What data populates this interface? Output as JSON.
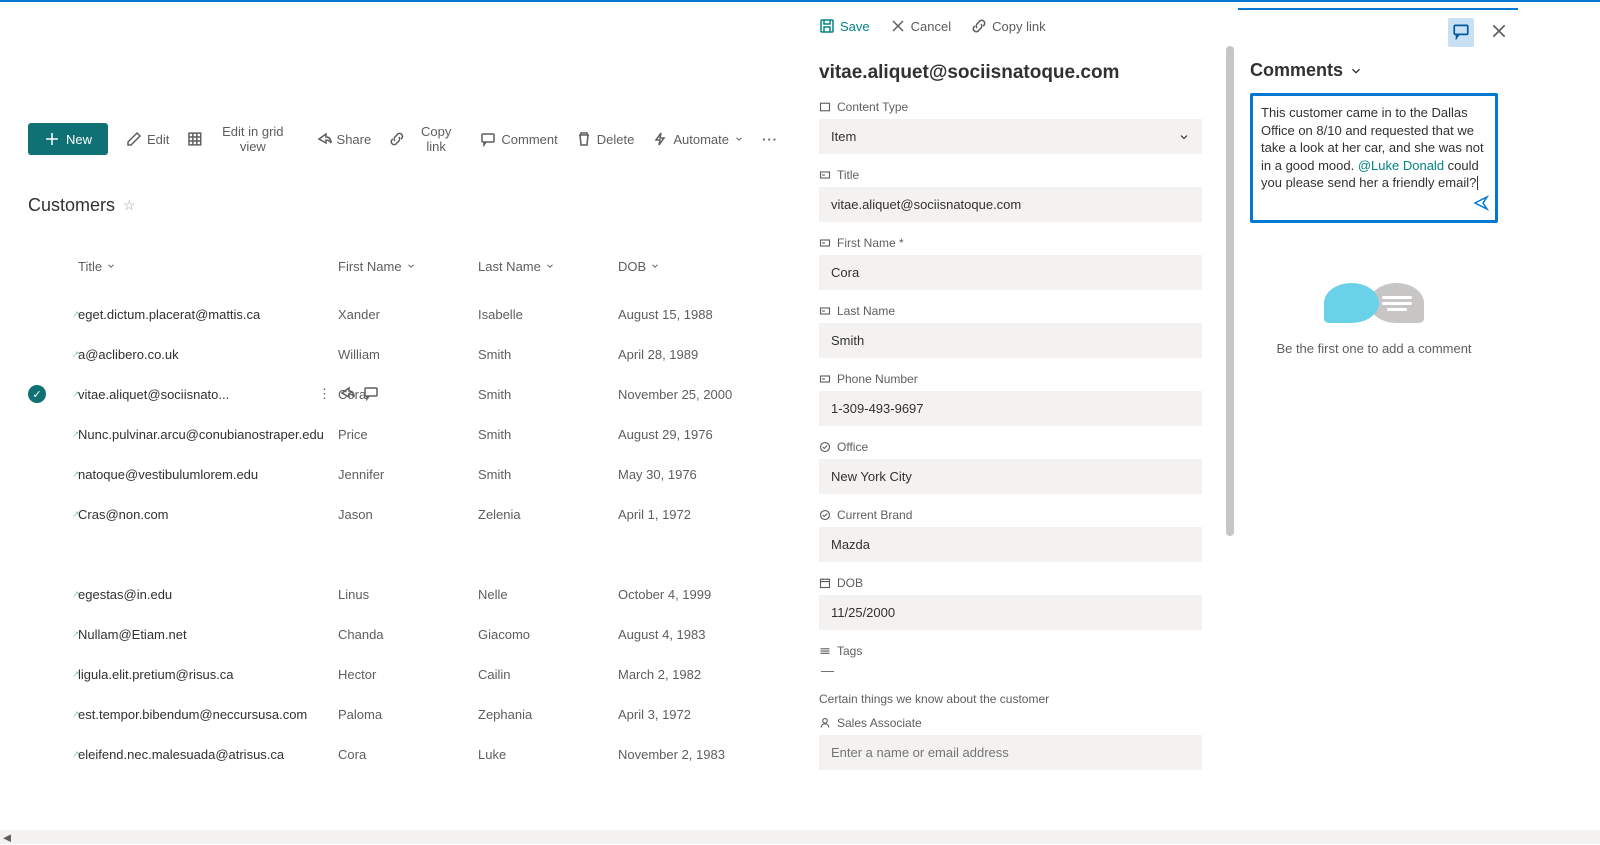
{
  "toolbar": {
    "new": "New",
    "edit": "Edit",
    "editGrid": "Edit in grid view",
    "share": "Share",
    "copyLink": "Copy link",
    "comment": "Comment",
    "delete": "Delete",
    "automate": "Automate"
  },
  "list": {
    "title": "Customers",
    "columns": {
      "title": "Title",
      "firstName": "First Name",
      "lastName": "Last Name",
      "dob": "DOB"
    },
    "rows": [
      {
        "title": "eget.dictum.placerat@mattis.ca",
        "first": "Xander",
        "last": "Isabelle",
        "dob": "August 15, 1988"
      },
      {
        "title": "a@aclibero.co.uk",
        "first": "William",
        "last": "Smith",
        "dob": "April 28, 1989"
      },
      {
        "title": "vitae.aliquet@sociisnato...",
        "first": "Cora",
        "last": "Smith",
        "dob": "November 25, 2000",
        "selected": true
      },
      {
        "title": "Nunc.pulvinar.arcu@conubianostraper.edu",
        "first": "Price",
        "last": "Smith",
        "dob": "August 29, 1976"
      },
      {
        "title": "natoque@vestibulumlorem.edu",
        "first": "Jennifer",
        "last": "Smith",
        "dob": "May 30, 1976"
      },
      {
        "title": "Cras@non.com",
        "first": "Jason",
        "last": "Zelenia",
        "dob": "April 1, 1972"
      },
      {
        "title": "egestas@in.edu",
        "first": "Linus",
        "last": "Nelle",
        "dob": "October 4, 1999"
      },
      {
        "title": "Nullam@Etiam.net",
        "first": "Chanda",
        "last": "Giacomo",
        "dob": "August 4, 1983"
      },
      {
        "title": "ligula.elit.pretium@risus.ca",
        "first": "Hector",
        "last": "Cailin",
        "dob": "March 2, 1982"
      },
      {
        "title": "est.tempor.bibendum@neccursusa.com",
        "first": "Paloma",
        "last": "Zephania",
        "dob": "April 3, 1972"
      },
      {
        "title": "eleifend.nec.malesuada@atrisus.ca",
        "first": "Cora",
        "last": "Luke",
        "dob": "November 2, 1983"
      }
    ]
  },
  "details": {
    "toolbar": {
      "save": "Save",
      "cancel": "Cancel",
      "copyLink": "Copy link"
    },
    "title": "vitae.aliquet@sociisnatoque.com",
    "fields": {
      "contentType": {
        "label": "Content Type",
        "value": "Item"
      },
      "titleField": {
        "label": "Title",
        "value": "vitae.aliquet@sociisnatoque.com"
      },
      "firstName": {
        "label": "First Name *",
        "value": "Cora"
      },
      "lastName": {
        "label": "Last Name",
        "value": "Smith"
      },
      "phone": {
        "label": "Phone Number",
        "value": "1-309-493-9697"
      },
      "office": {
        "label": "Office",
        "value": "New York City"
      },
      "brand": {
        "label": "Current Brand",
        "value": "Mazda"
      },
      "dob": {
        "label": "DOB",
        "value": "11/25/2000"
      },
      "tags": {
        "label": "Tags",
        "value": "—"
      },
      "hint": "Certain things we know about the customer",
      "sales": {
        "label": "Sales Associate",
        "placeholder": "Enter a name or email address"
      }
    }
  },
  "comments": {
    "header": "Comments",
    "draft": {
      "before": "This customer came in to the Dallas Office on 8/10 and requested that we take a look at her car, and she was not in a good mood. ",
      "mention": "@Luke Donald",
      "after": " could you please send her a friendly email?"
    },
    "empty": "Be the first one to add a comment"
  }
}
